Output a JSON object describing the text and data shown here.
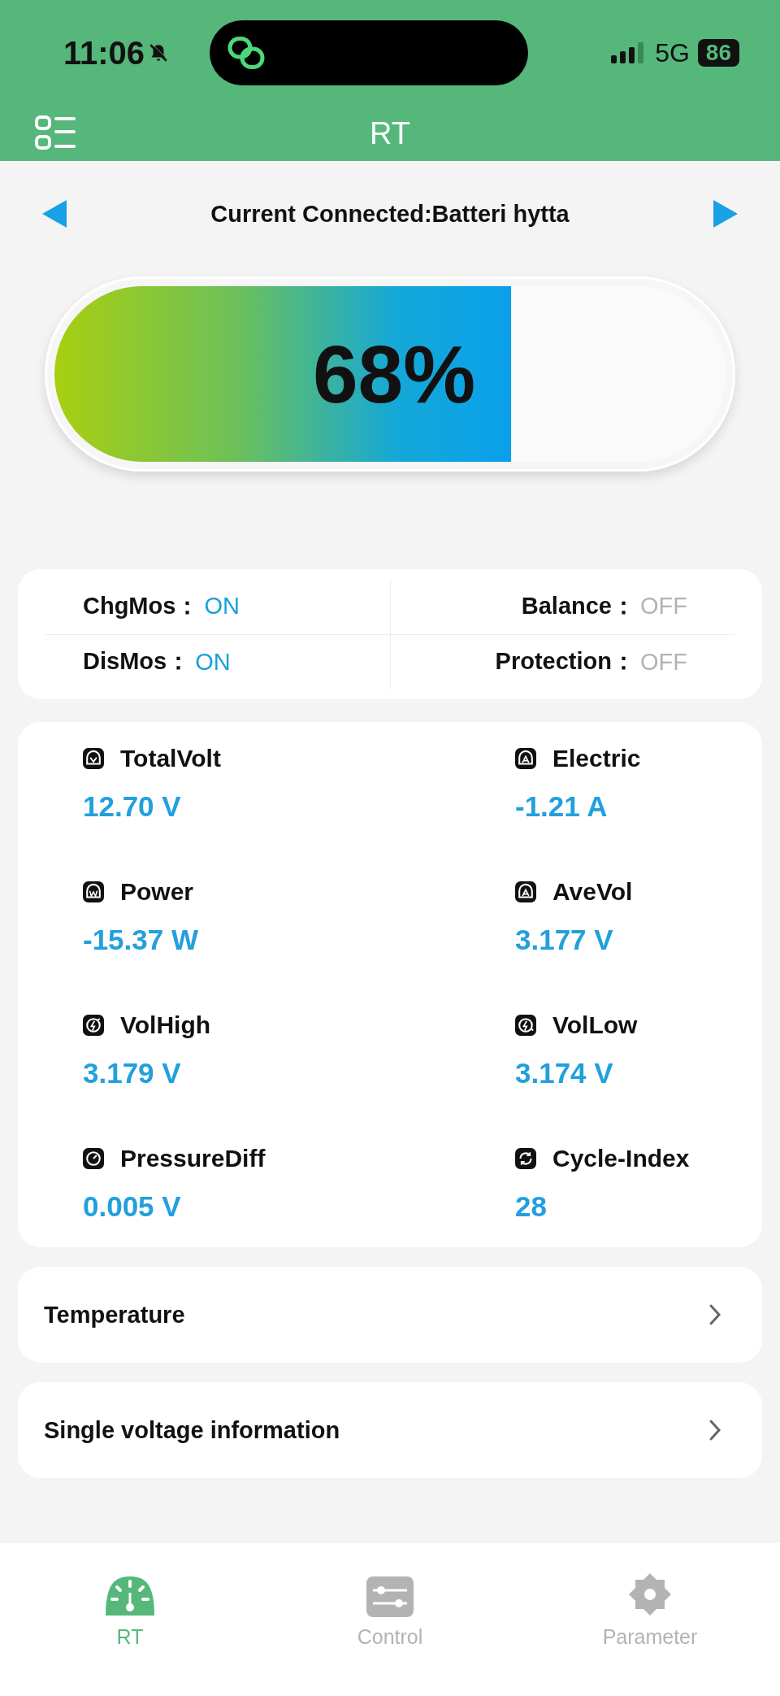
{
  "status_bar": {
    "time": "11:06",
    "network": "5G",
    "battery": "86"
  },
  "header": {
    "title": "RT"
  },
  "device": {
    "label": "Current Connected:Batteri hytta"
  },
  "soc": {
    "reading": "68%",
    "level": 0.68
  },
  "switches": [
    {
      "label": "ChgMos：",
      "value": "ON",
      "on": true
    },
    {
      "label": "Balance：",
      "value": "OFF",
      "on": false
    },
    {
      "label": "DisMos：",
      "value": "ON",
      "on": true
    },
    {
      "label": "Protection：",
      "value": "OFF",
      "on": false
    }
  ],
  "metrics": [
    {
      "kind": "volt",
      "label": "TotalVolt",
      "value": "12.70 V"
    },
    {
      "kind": "amp",
      "label": "Electric",
      "value": "-1.21 A"
    },
    {
      "kind": "watt",
      "label": "Power",
      "value": "-15.37 W"
    },
    {
      "kind": "amp",
      "label": "AveVol",
      "value": "3.177 V"
    },
    {
      "kind": "high",
      "label": "VolHigh",
      "value": "3.179 V"
    },
    {
      "kind": "low",
      "label": "VolLow",
      "value": "3.174 V"
    },
    {
      "kind": "diff",
      "label": "PressureDiff",
      "value": "0.005 V"
    },
    {
      "kind": "cycle",
      "label": "Cycle-Index",
      "value": "28"
    }
  ],
  "links": [
    {
      "label": "Temperature"
    },
    {
      "label": "Single voltage information"
    }
  ],
  "tabs": [
    {
      "kind": "gauge",
      "label": "RT",
      "selected": true
    },
    {
      "kind": "sliders",
      "label": "Control",
      "selected": false
    },
    {
      "kind": "gear",
      "label": "Parameter",
      "selected": false
    }
  ]
}
